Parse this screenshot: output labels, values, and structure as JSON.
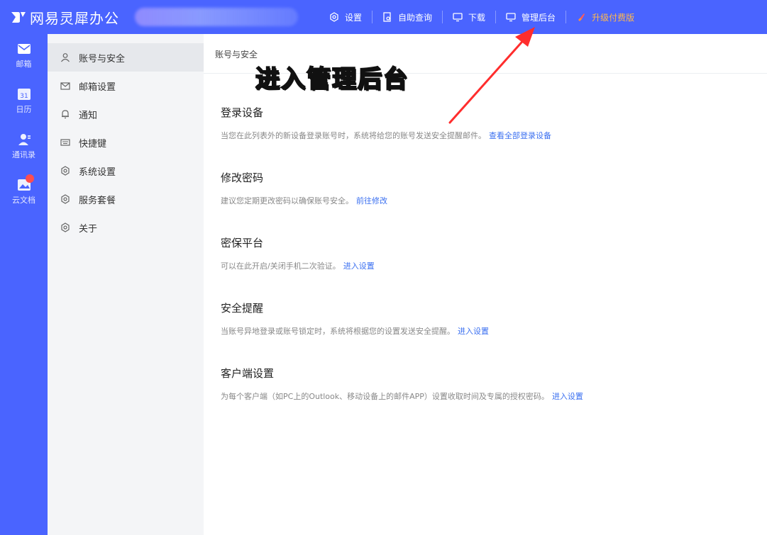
{
  "app": {
    "title": "网易灵犀办公"
  },
  "nav": [
    {
      "label": "设置",
      "icon": "gear-icon"
    },
    {
      "label": "自助查询",
      "icon": "document-search-icon"
    },
    {
      "label": "下载",
      "icon": "monitor-icon"
    },
    {
      "label": "管理后台",
      "icon": "monitor-icon"
    },
    {
      "label": "升级付费版",
      "icon": "rocket-icon"
    }
  ],
  "rail": [
    {
      "label": "邮箱",
      "icon": "mail-icon"
    },
    {
      "label": "日历",
      "icon": "calendar-icon",
      "date": "31"
    },
    {
      "label": "通讯录",
      "icon": "contacts-icon"
    },
    {
      "label": "云文档",
      "icon": "cloud-doc-icon"
    }
  ],
  "sidebar": [
    {
      "label": "账号与安全",
      "icon": "user-icon"
    },
    {
      "label": "邮箱设置",
      "icon": "mail-icon"
    },
    {
      "label": "通知",
      "icon": "bell-icon"
    },
    {
      "label": "快捷键",
      "icon": "keyboard-icon"
    },
    {
      "label": "系统设置",
      "icon": "gear-icon"
    },
    {
      "label": "服务套餐",
      "icon": "gear-icon"
    },
    {
      "label": "关于",
      "icon": "gear-icon"
    }
  ],
  "main": {
    "breadcrumb": "账号与安全",
    "sections": [
      {
        "title": "登录设备",
        "desc": "当您在此列表外的新设备登录账号时，系统将给您的账号发送安全提醒邮件。",
        "link": "查看全部登录设备"
      },
      {
        "title": "修改密码",
        "desc": "建议您定期更改密码以确保账号安全。",
        "link": "前往修改"
      },
      {
        "title": "密保平台",
        "desc": "可以在此开启/关闭手机二次验证。",
        "link": "进入设置"
      },
      {
        "title": "安全提醒",
        "desc": "当账号异地登录或账号锁定时，系统将根据您的设置发送安全提醒。",
        "link": "进入设置"
      },
      {
        "title": "客户端设置",
        "desc": "为每个客户端（如PC上的Outlook、移动设备上的邮件APP）设置收取时间及专属的授权密码。",
        "link": "进入设置"
      }
    ]
  },
  "annotation": {
    "text": "进入管理后台"
  },
  "colors": {
    "brand": "#4a64ff",
    "link": "#3a6ff0",
    "upgrade": "#ffb84d",
    "arrow": "#ff2d2d",
    "annotation": "#ffe600"
  }
}
